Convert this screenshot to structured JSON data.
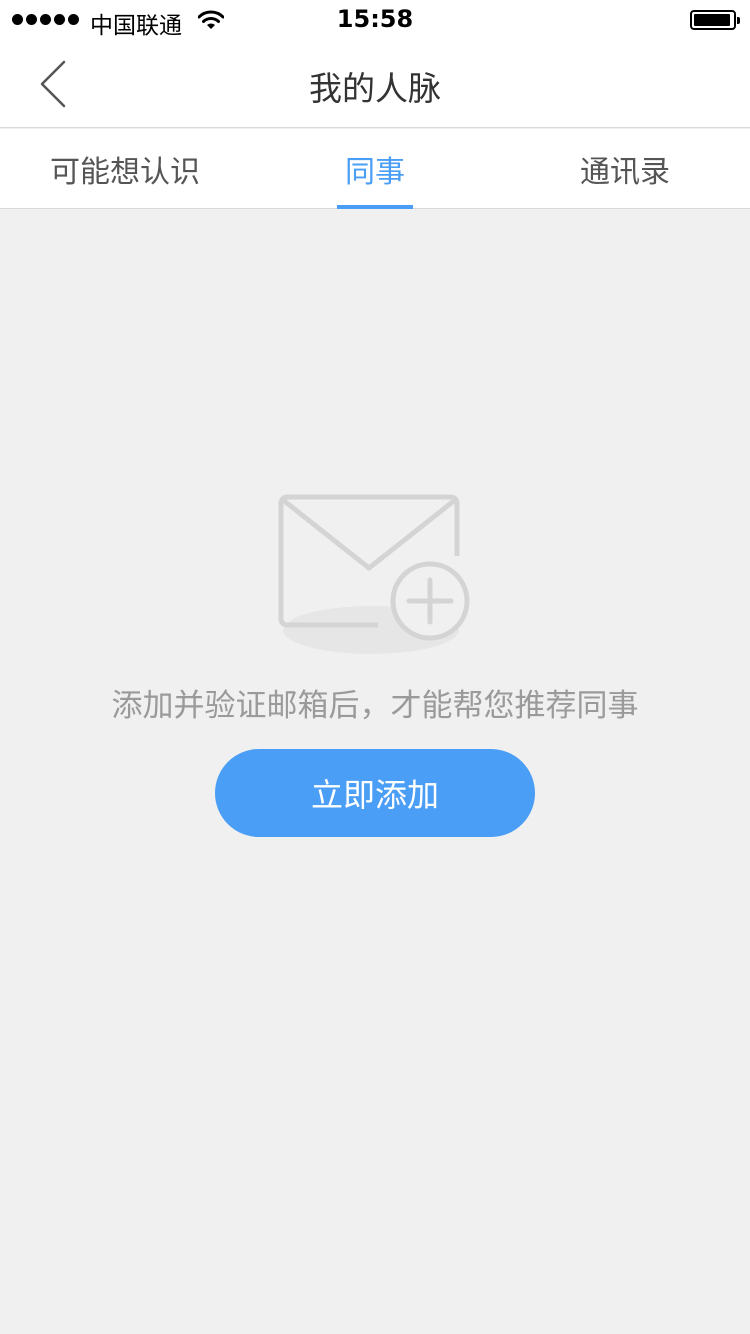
{
  "status_bar": {
    "carrier": "中国联通",
    "time": "15:58",
    "signal_icon": "signal-dots-icon",
    "wifi_icon": "wifi-icon",
    "battery_icon": "battery-icon"
  },
  "nav": {
    "title": "我的人脉",
    "back_icon": "chevron-left-icon"
  },
  "tabs": [
    {
      "label": "可能想认识",
      "active": false
    },
    {
      "label": "同事",
      "active": true
    },
    {
      "label": "通讯录",
      "active": false
    }
  ],
  "empty_state": {
    "icon": "mail-add-icon",
    "message": "添加并验证邮箱后，才能帮您推荐同事",
    "button_label": "立即添加"
  },
  "colors": {
    "accent": "#4a9ef5",
    "background": "#f0f0f0",
    "icon_gray": "#d4d4d4",
    "text_gray": "#9a9a9a"
  }
}
